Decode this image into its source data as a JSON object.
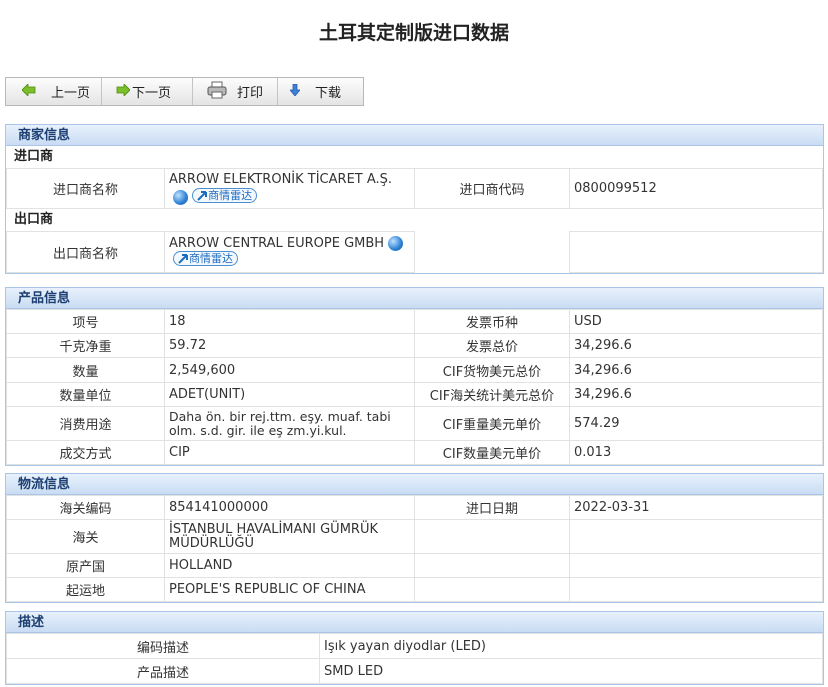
{
  "title": "土耳其定制版进口数据",
  "toolbar": {
    "prev": "上一页",
    "next": "下一页",
    "print": "打印",
    "download": "下载"
  },
  "merchant": {
    "heading": "商家信息",
    "importer_heading": "进口商",
    "importer_name_label": "进口商名称",
    "importer_name": "ARROW ELEKTRONİK TİCARET A.Ş.",
    "importer_code_label": "进口商代码",
    "importer_code": "0800099512",
    "exporter_heading": "出口商",
    "exporter_name_label": "出口商名称",
    "exporter_name": "ARROW CENTRAL EUROPE GMBH",
    "radar_label": "商情雷达"
  },
  "product": {
    "heading": "产品信息",
    "rows": [
      {
        "l1": "项号",
        "v1": "18",
        "l2": "发票币种",
        "v2": "USD"
      },
      {
        "l1": "千克净重",
        "v1": "59.72",
        "l2": "发票总价",
        "v2": "34,296.6"
      },
      {
        "l1": "数量",
        "v1": "2,549,600",
        "l2": "CIF货物美元总价",
        "v2": "34,296.6"
      },
      {
        "l1": "数量单位",
        "v1": "ADET(UNIT)",
        "l2": "CIF海关统计美元总价",
        "v2": "34,296.6"
      },
      {
        "l1": "消费用途",
        "v1": "Daha ön. bir rej.ttm. eşy. muaf. tabi olm. s.d. gir. ile eş zm.yi.kul.",
        "l2": "CIF重量美元单价",
        "v2": "574.29"
      },
      {
        "l1": "成交方式",
        "v1": "CIP",
        "l2": "CIF数量美元单价",
        "v2": "0.013"
      }
    ]
  },
  "logistics": {
    "heading": "物流信息",
    "hs_label": "海关编码",
    "hs": "854141000000",
    "date_label": "进口日期",
    "date": "2022-03-31",
    "customs_label": "海关",
    "customs": "İSTANBUL HAVALİMANI GÜMRÜK MÜDÜRLÜĞÜ",
    "origin_label": "原产国",
    "origin": "HOLLAND",
    "departure_label": "起运地",
    "departure": "PEOPLE'S REPUBLIC OF CHINA"
  },
  "description": {
    "heading": "描述",
    "code_desc_label": "编码描述",
    "code_desc": "Işık yayan diyodlar (LED)",
    "product_desc_label": "产品描述",
    "product_desc": "SMD LED"
  },
  "colors": {
    "section_border": "#a9c6e8",
    "section_title": "#1d3f72",
    "radar_link": "#1d6cc0"
  }
}
